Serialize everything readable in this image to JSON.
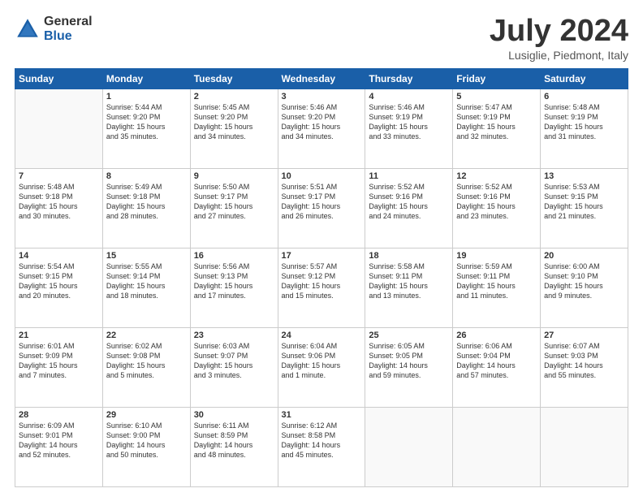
{
  "logo": {
    "general": "General",
    "blue": "Blue"
  },
  "header": {
    "month": "July 2024",
    "location": "Lusiglie, Piedmont, Italy"
  },
  "weekdays": [
    "Sunday",
    "Monday",
    "Tuesday",
    "Wednesday",
    "Thursday",
    "Friday",
    "Saturday"
  ],
  "weeks": [
    [
      {
        "day": "",
        "info": ""
      },
      {
        "day": "1",
        "info": "Sunrise: 5:44 AM\nSunset: 9:20 PM\nDaylight: 15 hours\nand 35 minutes."
      },
      {
        "day": "2",
        "info": "Sunrise: 5:45 AM\nSunset: 9:20 PM\nDaylight: 15 hours\nand 34 minutes."
      },
      {
        "day": "3",
        "info": "Sunrise: 5:46 AM\nSunset: 9:20 PM\nDaylight: 15 hours\nand 34 minutes."
      },
      {
        "day": "4",
        "info": "Sunrise: 5:46 AM\nSunset: 9:19 PM\nDaylight: 15 hours\nand 33 minutes."
      },
      {
        "day": "5",
        "info": "Sunrise: 5:47 AM\nSunset: 9:19 PM\nDaylight: 15 hours\nand 32 minutes."
      },
      {
        "day": "6",
        "info": "Sunrise: 5:48 AM\nSunset: 9:19 PM\nDaylight: 15 hours\nand 31 minutes."
      }
    ],
    [
      {
        "day": "7",
        "info": "Sunrise: 5:48 AM\nSunset: 9:18 PM\nDaylight: 15 hours\nand 30 minutes."
      },
      {
        "day": "8",
        "info": "Sunrise: 5:49 AM\nSunset: 9:18 PM\nDaylight: 15 hours\nand 28 minutes."
      },
      {
        "day": "9",
        "info": "Sunrise: 5:50 AM\nSunset: 9:17 PM\nDaylight: 15 hours\nand 27 minutes."
      },
      {
        "day": "10",
        "info": "Sunrise: 5:51 AM\nSunset: 9:17 PM\nDaylight: 15 hours\nand 26 minutes."
      },
      {
        "day": "11",
        "info": "Sunrise: 5:52 AM\nSunset: 9:16 PM\nDaylight: 15 hours\nand 24 minutes."
      },
      {
        "day": "12",
        "info": "Sunrise: 5:52 AM\nSunset: 9:16 PM\nDaylight: 15 hours\nand 23 minutes."
      },
      {
        "day": "13",
        "info": "Sunrise: 5:53 AM\nSunset: 9:15 PM\nDaylight: 15 hours\nand 21 minutes."
      }
    ],
    [
      {
        "day": "14",
        "info": "Sunrise: 5:54 AM\nSunset: 9:15 PM\nDaylight: 15 hours\nand 20 minutes."
      },
      {
        "day": "15",
        "info": "Sunrise: 5:55 AM\nSunset: 9:14 PM\nDaylight: 15 hours\nand 18 minutes."
      },
      {
        "day": "16",
        "info": "Sunrise: 5:56 AM\nSunset: 9:13 PM\nDaylight: 15 hours\nand 17 minutes."
      },
      {
        "day": "17",
        "info": "Sunrise: 5:57 AM\nSunset: 9:12 PM\nDaylight: 15 hours\nand 15 minutes."
      },
      {
        "day": "18",
        "info": "Sunrise: 5:58 AM\nSunset: 9:11 PM\nDaylight: 15 hours\nand 13 minutes."
      },
      {
        "day": "19",
        "info": "Sunrise: 5:59 AM\nSunset: 9:11 PM\nDaylight: 15 hours\nand 11 minutes."
      },
      {
        "day": "20",
        "info": "Sunrise: 6:00 AM\nSunset: 9:10 PM\nDaylight: 15 hours\nand 9 minutes."
      }
    ],
    [
      {
        "day": "21",
        "info": "Sunrise: 6:01 AM\nSunset: 9:09 PM\nDaylight: 15 hours\nand 7 minutes."
      },
      {
        "day": "22",
        "info": "Sunrise: 6:02 AM\nSunset: 9:08 PM\nDaylight: 15 hours\nand 5 minutes."
      },
      {
        "day": "23",
        "info": "Sunrise: 6:03 AM\nSunset: 9:07 PM\nDaylight: 15 hours\nand 3 minutes."
      },
      {
        "day": "24",
        "info": "Sunrise: 6:04 AM\nSunset: 9:06 PM\nDaylight: 15 hours\nand 1 minute."
      },
      {
        "day": "25",
        "info": "Sunrise: 6:05 AM\nSunset: 9:05 PM\nDaylight: 14 hours\nand 59 minutes."
      },
      {
        "day": "26",
        "info": "Sunrise: 6:06 AM\nSunset: 9:04 PM\nDaylight: 14 hours\nand 57 minutes."
      },
      {
        "day": "27",
        "info": "Sunrise: 6:07 AM\nSunset: 9:03 PM\nDaylight: 14 hours\nand 55 minutes."
      }
    ],
    [
      {
        "day": "28",
        "info": "Sunrise: 6:09 AM\nSunset: 9:01 PM\nDaylight: 14 hours\nand 52 minutes."
      },
      {
        "day": "29",
        "info": "Sunrise: 6:10 AM\nSunset: 9:00 PM\nDaylight: 14 hours\nand 50 minutes."
      },
      {
        "day": "30",
        "info": "Sunrise: 6:11 AM\nSunset: 8:59 PM\nDaylight: 14 hours\nand 48 minutes."
      },
      {
        "day": "31",
        "info": "Sunrise: 6:12 AM\nSunset: 8:58 PM\nDaylight: 14 hours\nand 45 minutes."
      },
      {
        "day": "",
        "info": ""
      },
      {
        "day": "",
        "info": ""
      },
      {
        "day": "",
        "info": ""
      }
    ]
  ]
}
